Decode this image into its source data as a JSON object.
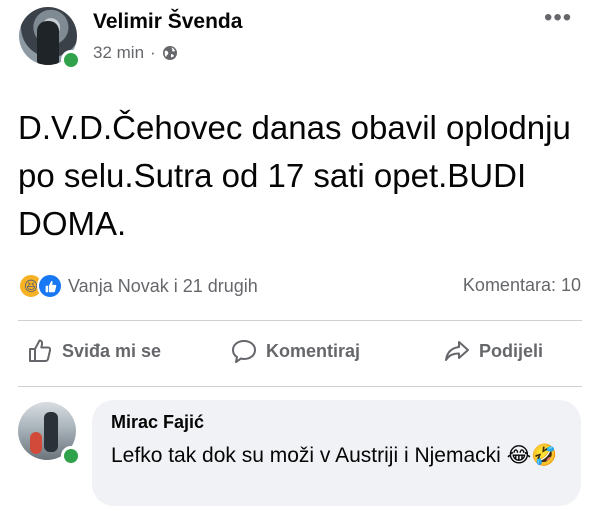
{
  "post": {
    "author": "Velimir Švenda",
    "time": "32 min",
    "separator": "·",
    "audience_icon": "globe-icon",
    "more_icon": "more-options-icon",
    "more_glyph": "•••",
    "text": "D.V.D.Čehovec danas obavil oplodnju po selu.Sutra od 17 sati opet.BUDI DOMA."
  },
  "reactions": {
    "types": [
      "haha",
      "like"
    ],
    "haha_glyph": "😆",
    "like_glyph": "👍",
    "summary": "Vanja Novak i 21 drugih",
    "comments": "Komentara: 10"
  },
  "actions": {
    "like_label": "Sviđa mi se",
    "comment_label": "Komentiraj",
    "share_label": "Podijeli"
  },
  "comment": {
    "author": "Mirac Fajić",
    "text": "Lefko tak dok su moži v Austriji i Njemacki 😂🤣"
  },
  "colors": {
    "text": "#050505",
    "secondary": "#65676b",
    "online": "#31a24c",
    "like_blue": "#1877f2",
    "haha_yellow": "#f7b125",
    "bubble": "#f0f2f5",
    "divider": "#ced0d4"
  }
}
